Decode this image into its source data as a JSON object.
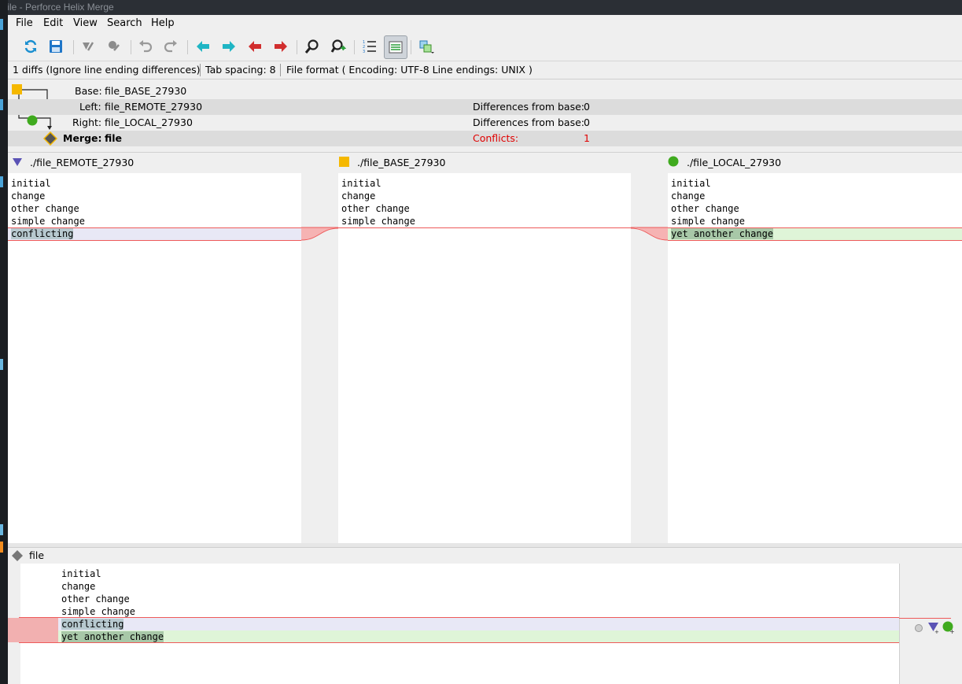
{
  "window": {
    "title": "file - Perforce Helix Merge"
  },
  "menu": {
    "items": [
      "File",
      "Edit",
      "View",
      "Search",
      "Help"
    ]
  },
  "toolbar": {
    "buttons": [
      "refresh-icon",
      "save-icon",
      "accept-left-icon",
      "accept-right-icon",
      "undo-icon",
      "redo-icon",
      "prev-diff-icon",
      "next-diff-icon",
      "prev-conflict-icon",
      "next-conflict-icon",
      "find-icon",
      "find-next-icon",
      "line-numbers-icon",
      "show-merged-icon",
      "layout-icon"
    ],
    "active": "show-merged-icon"
  },
  "infobar": {
    "diffs": "1 diffs (Ignore line ending differences)",
    "tab_spacing": "Tab spacing: 8",
    "file_format": "File format ( Encoding: UTF-8  Line endings: UNIX )"
  },
  "header": {
    "base_label": "Base:",
    "base_value": "file_BASE_27930",
    "left_label": "Left:",
    "left_value": "file_REMOTE_27930",
    "left_diff_label": "Differences from base:",
    "left_diff_value": "0",
    "right_label": "Right:",
    "right_value": "file_LOCAL_27930",
    "right_diff_label": "Differences from base:",
    "right_diff_value": "0",
    "merge_label": "Merge:",
    "merge_value": "file",
    "conflicts_label": "Conflicts:",
    "conflicts_value": "1"
  },
  "columns": {
    "left": "./file_REMOTE_27930",
    "base": "./file_BASE_27930",
    "right": "./file_LOCAL_27930"
  },
  "panes": {
    "left": [
      "initial",
      "change",
      "other change",
      "simple change",
      "conflicting"
    ],
    "base": [
      "initial",
      "change",
      "other change",
      "simple change"
    ],
    "right": [
      "initial",
      "change",
      "other change",
      "simple change",
      "yet another change"
    ]
  },
  "merge": {
    "title": "file",
    "lines": [
      "initial",
      "change",
      "other change",
      "simple change",
      "conflicting",
      "yet another change"
    ]
  },
  "colors": {
    "left_marker": "#5a52b5",
    "base_marker": "#f5b800",
    "right_marker": "#3faa1e",
    "conflict": "#e00000"
  }
}
